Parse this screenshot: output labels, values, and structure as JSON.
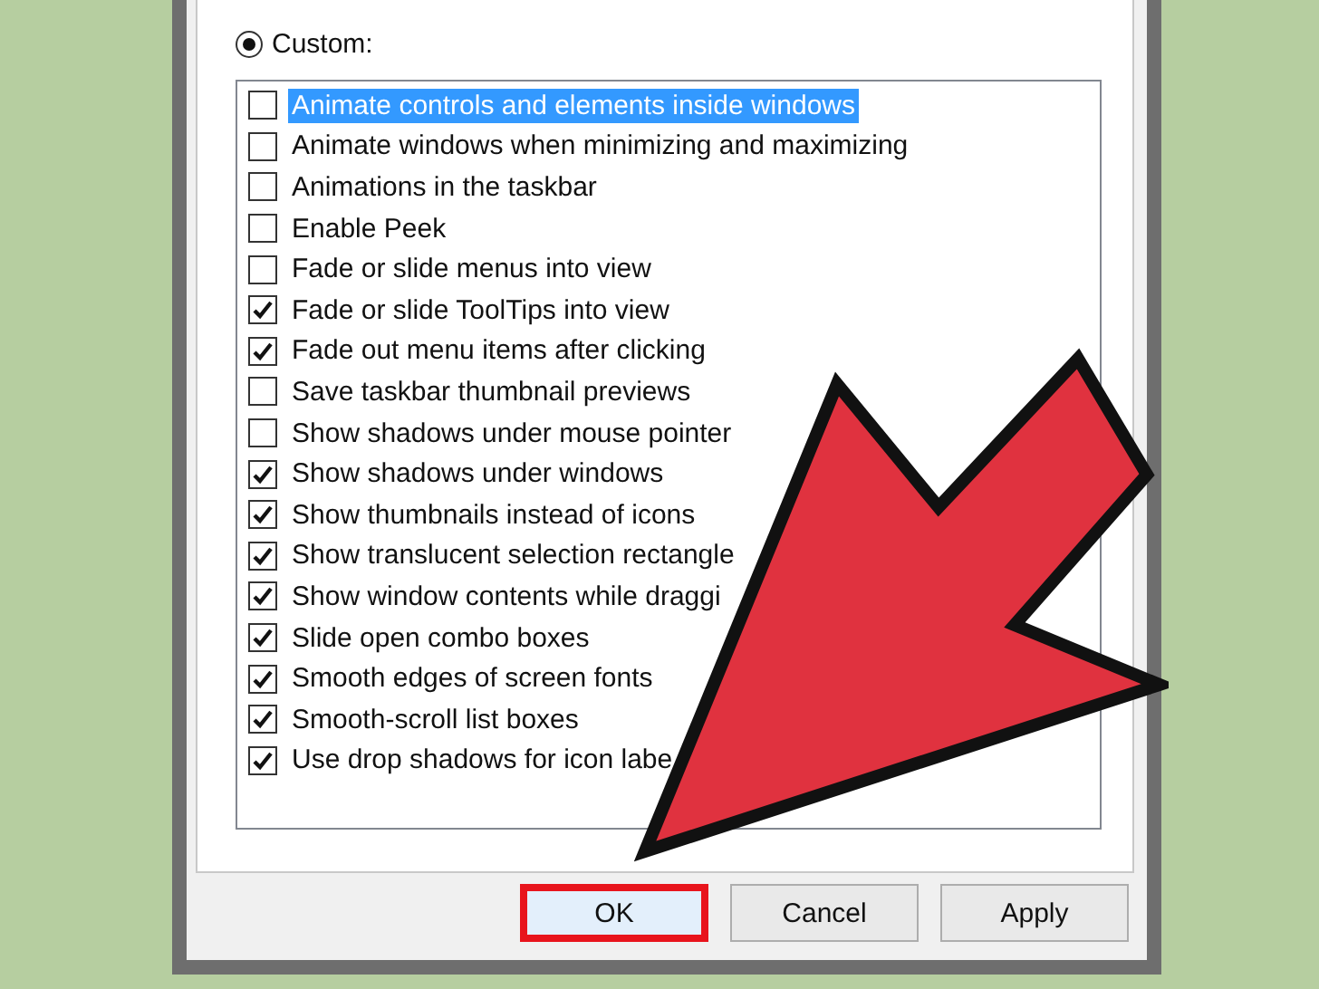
{
  "custom_option": {
    "label": "Custom:",
    "selected": true
  },
  "options": [
    {
      "label": "Animate controls and elements inside windows",
      "checked": false,
      "selected": true
    },
    {
      "label": "Animate windows when minimizing and maximizing",
      "checked": false,
      "selected": false
    },
    {
      "label": "Animations in the taskbar",
      "checked": false,
      "selected": false
    },
    {
      "label": "Enable Peek",
      "checked": false,
      "selected": false
    },
    {
      "label": "Fade or slide menus into view",
      "checked": false,
      "selected": false
    },
    {
      "label": "Fade or slide ToolTips into view",
      "checked": true,
      "selected": false
    },
    {
      "label": "Fade out menu items after clicking",
      "checked": true,
      "selected": false
    },
    {
      "label": "Save taskbar thumbnail previews",
      "checked": false,
      "selected": false
    },
    {
      "label": "Show shadows under mouse pointer",
      "checked": false,
      "selected": false
    },
    {
      "label": "Show shadows under windows",
      "checked": true,
      "selected": false
    },
    {
      "label": "Show thumbnails instead of icons",
      "checked": true,
      "selected": false
    },
    {
      "label": "Show translucent selection rectangle",
      "checked": true,
      "selected": false
    },
    {
      "label": "Show window contents while draggi",
      "checked": true,
      "selected": false
    },
    {
      "label": "Slide open combo boxes",
      "checked": true,
      "selected": false
    },
    {
      "label": "Smooth edges of screen fonts",
      "checked": true,
      "selected": false
    },
    {
      "label": "Smooth-scroll list boxes",
      "checked": true,
      "selected": false
    },
    {
      "label": "Use drop shadows for icon labe",
      "checked": true,
      "selected": false
    }
  ],
  "buttons": [
    {
      "label": "OK",
      "highlighted": true
    },
    {
      "label": "Cancel",
      "highlighted": false
    },
    {
      "label": "Apply",
      "highlighted": false
    }
  ]
}
